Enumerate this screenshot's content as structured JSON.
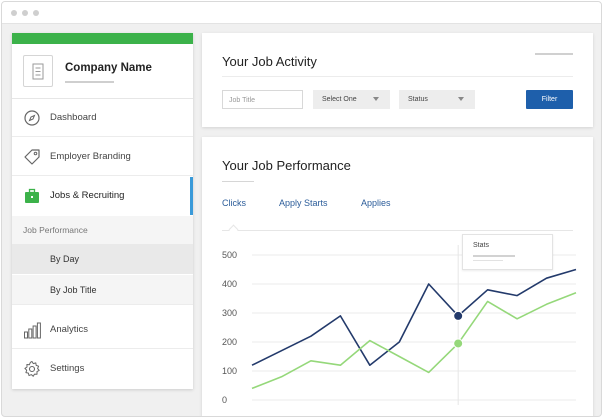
{
  "colors": {
    "brand_green": "#3cb24a",
    "nav_blue": "#1e5fab",
    "series_clicks": "#233a6b",
    "series_applies": "#95d87a",
    "tab_text": "#2c5d9a"
  },
  "sidebar": {
    "company": {
      "name": "Company Name",
      "icon": "building-icon"
    },
    "items": [
      {
        "label": "Dashboard",
        "icon": "compass-icon"
      },
      {
        "label": "Employer Branding",
        "icon": "tag-icon"
      },
      {
        "label": "Jobs & Recruiting",
        "icon": "briefcase-icon",
        "active": true
      },
      {
        "label": "Analytics",
        "icon": "bar-chart-icon"
      },
      {
        "label": "Settings",
        "icon": "gear-icon"
      }
    ],
    "submenu": {
      "header": "Job Performance",
      "items": [
        {
          "label": "By Day",
          "selected": true
        },
        {
          "label": "By Job Title",
          "selected": false
        }
      ]
    }
  },
  "activity": {
    "title": "Your Job Activity",
    "job_title_placeholder": "Job Title",
    "select_value": "Select One",
    "status_value": "Status",
    "filter_label": "Filter"
  },
  "performance": {
    "title": "Your Job Performance",
    "tabs": [
      {
        "label": "Clicks",
        "active": true
      },
      {
        "label": "Apply Starts",
        "active": false
      },
      {
        "label": "Applies",
        "active": false
      }
    ],
    "tooltip_title": "Stats"
  },
  "chart_data": {
    "type": "line",
    "title": "",
    "xlabel": "",
    "ylabel": "",
    "ylim": [
      0,
      500
    ],
    "yticks": [
      0,
      100,
      200,
      300,
      400,
      500
    ],
    "x": [
      0,
      1,
      2,
      3,
      4,
      5,
      6,
      7,
      8,
      9,
      10,
      11,
      12
    ],
    "series": [
      {
        "values": [
          120,
          170,
          220,
          290,
          120,
          200,
          400,
          290,
          380,
          360,
          420,
          450
        ],
        "highlight_index": 7
      },
      {
        "values": [
          40,
          80,
          135,
          120,
          205,
          150,
          95,
          195,
          340,
          280,
          330,
          370
        ],
        "highlight_index": 7
      }
    ]
  }
}
